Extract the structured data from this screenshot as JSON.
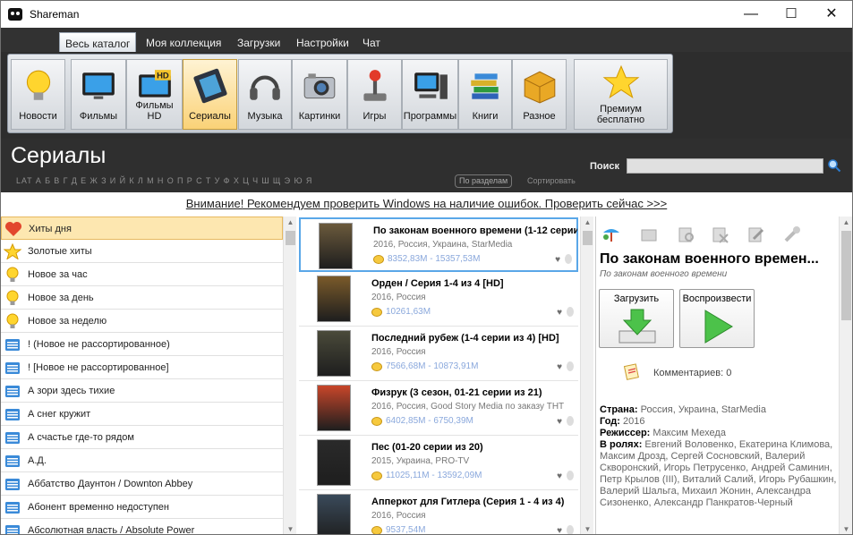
{
  "window": {
    "title": "Shareman",
    "minimize": "—",
    "maximize": "☐",
    "close": "✕"
  },
  "menu": {
    "items": [
      "Весь каталог",
      "Моя коллекция",
      "Загрузки",
      "Настройки",
      "Чат"
    ]
  },
  "categories": [
    "Новости",
    "Фильмы",
    "Фильмы HD",
    "Сериалы",
    "Музыка",
    "Картинки",
    "Игры",
    "Программы",
    "Книги",
    "Разное"
  ],
  "premium": {
    "line1": "Премиум",
    "line2": "бесплатно"
  },
  "section": {
    "title": "Сериалы",
    "alphabet": "LAT  А  Б  В  Г  Д  Е  Ж  З  И  Й  К  Л  М  Н  О  П  Р  С  Т  У  Ф  Х  Ц  Ч  Ш  Щ  Э  Ю  Я",
    "by_sections": "По разделам",
    "sort": "Сортировать",
    "search_label": "Поиск",
    "search_value": "",
    "notice": "Внимание! Рекомендуем проверить Windows на наличие ошибок. Проверить сейчас >>>"
  },
  "left_list": [
    {
      "label": "Хиты дня",
      "icon": "heart-icon",
      "selected": true
    },
    {
      "label": "Золотые хиты",
      "icon": "star-icon"
    },
    {
      "label": "Новое за час",
      "icon": "bulb-icon"
    },
    {
      "label": "Новое за день",
      "icon": "bulb-icon"
    },
    {
      "label": "Новое за неделю",
      "icon": "bulb-icon"
    },
    {
      "label": "!  (Новое не рассортированное)",
      "icon": "folder-icon"
    },
    {
      "label": "! [Новое не рассортированное]",
      "icon": "folder-icon"
    },
    {
      "label": "А зори здесь тихие",
      "icon": "folder-icon"
    },
    {
      "label": "А снег кружит",
      "icon": "folder-icon"
    },
    {
      "label": "А счастье где-то рядом",
      "icon": "folder-icon"
    },
    {
      "label": "А.Д.",
      "icon": "folder-icon"
    },
    {
      "label": "Аббатство Даунтон / Downton Abbey",
      "icon": "folder-icon"
    },
    {
      "label": "Абонент временно недоступен",
      "icon": "folder-icon"
    },
    {
      "label": "Абсолютная власть / Absolute Power",
      "icon": "folder-icon"
    }
  ],
  "series_list": [
    {
      "title": "По законам военного времени (1-12 серии",
      "meta": "2016, Россия, Украина, StarMedia",
      "size": "8352,83M - 15357,53M",
      "poster_color": "#6b5a3c",
      "selected": true
    },
    {
      "title": "Орден / Серия 1-4 из 4 [HD]",
      "meta": "2016, Россия",
      "size": "10261,63M",
      "poster_color": "#7a5a2a"
    },
    {
      "title": "Последний рубеж (1-4 серии из 4) [HD]",
      "meta": "2016, Россия",
      "size": "7566,68M - 10873,91M",
      "poster_color": "#4a4a3a"
    },
    {
      "title": "Физрук (3 сезон, 01-21 серии из 21)",
      "meta": "2016, Россия, Good Story Media по заказу THT",
      "size": "6402,85M - 6750,39M",
      "poster_color": "#c8462a"
    },
    {
      "title": "Пес  (01-20 серии из 20)",
      "meta": "2015, Украина, PRO-TV",
      "size": "11025,11M - 13592,09M",
      "poster_color": "#2a2a2a"
    },
    {
      "title": "Апперкот для Гитлера (Серия 1 - 4 из 4)",
      "meta": "2016, Россия",
      "size": "9537,54M",
      "poster_color": "#3a4a5a"
    }
  ],
  "detail": {
    "title": "По законам военного времен...",
    "subtitle": "По законам военного времени",
    "download": "Загрузить",
    "play": "Воспроизвести",
    "comments": "Комментариев: 0",
    "country_label": "Страна:",
    "country": "Россия, Украина, StarMedia",
    "year_label": "Год:",
    "year": "2016",
    "director_label": "Режиссер:",
    "director": "Максим Мехеда",
    "cast_label": "В ролях:",
    "cast": "Евгений Воловенко, Екатерина Климова, Максим Дрозд, Сергей Сосновский, Валерий Скворонский, Игорь Петрусенко, Андрей Саминин, Петр Крылов (III), Виталий Салий, Игорь Рубашкин, Валерий Шальга, Михаил Жонин, Александра Сизоненко, Александр Панкратов-Черный"
  },
  "colors": {
    "accent": "#5aa7e8",
    "selection": "#fde7b0",
    "toolbar": "#2f2f2f"
  }
}
